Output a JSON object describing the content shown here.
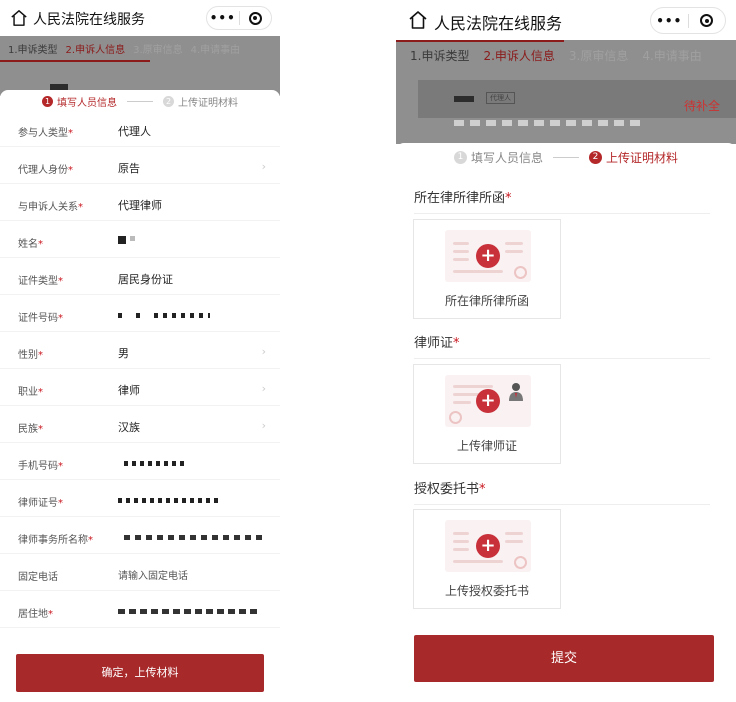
{
  "app": {
    "title": "人民法院在线服务"
  },
  "capsule": {
    "more": "•••"
  },
  "steps": [
    {
      "label": "1.申诉类型",
      "state": "done"
    },
    {
      "label": "2.申诉人信息",
      "state": "active"
    },
    {
      "label": "3.原审信息",
      "state": "todo"
    },
    {
      "label": "4.申请事由",
      "state": "todo"
    }
  ],
  "backdrop": {
    "tag": "代理人",
    "pending": "待补全"
  },
  "tabs": [
    {
      "num": "1",
      "label": "填写人员信息"
    },
    {
      "num": "2",
      "label": "上传证明材料"
    }
  ],
  "left_form": {
    "rows": [
      {
        "label": "参与人类型",
        "required": "*",
        "value": "代理人",
        "chevron": ""
      },
      {
        "label": "代理人身份",
        "required": "*",
        "value": "原告",
        "chevron": "›"
      },
      {
        "label": "与申诉人关系",
        "required": "*",
        "value": "代理律师",
        "chevron": ""
      },
      {
        "label": "姓名",
        "required": "*",
        "value": "",
        "chevron": ""
      },
      {
        "label": "证件类型",
        "required": "*",
        "value": "居民身份证",
        "chevron": ""
      },
      {
        "label": "证件号码",
        "required": "*",
        "value": "",
        "chevron": ""
      },
      {
        "label": "性别",
        "required": "*",
        "value": "男",
        "chevron": "›"
      },
      {
        "label": "职业",
        "required": "*",
        "value": "律师",
        "chevron": "›"
      },
      {
        "label": "民族",
        "required": "*",
        "value": "汉族",
        "chevron": "›"
      },
      {
        "label": "手机号码",
        "required": "*",
        "value": "",
        "chevron": ""
      },
      {
        "label": "律师证号",
        "required": "*",
        "value": "",
        "chevron": ""
      },
      {
        "label": "律师事务所名称",
        "required": "*",
        "value": "",
        "chevron": ""
      },
      {
        "label": "固定电话",
        "required": "",
        "value": "",
        "chevron": "",
        "placeholder": "请输入固定电话"
      },
      {
        "label": "居住地",
        "required": "*",
        "value": "",
        "chevron": ""
      }
    ],
    "confirm_label": "确定，上传材料"
  },
  "uploads": [
    {
      "title": "所在律所律所函",
      "required": "*",
      "caption": "所在律所律所函",
      "has_person": false
    },
    {
      "title": "律师证",
      "required": "*",
      "caption": "上传律师证",
      "has_person": true
    },
    {
      "title": "授权委托书",
      "required": "*",
      "caption": "上传授权委托书",
      "has_person": false
    }
  ],
  "submit_label": "提交",
  "colors": {
    "accent": "#a8292a",
    "required": "#c8161e",
    "dim": "#8f8f8f"
  },
  "icons": {
    "home": "home-icon",
    "more": "more-icon",
    "target": "target-icon",
    "add": "add-icon",
    "chevron": "chevron-right-icon"
  }
}
